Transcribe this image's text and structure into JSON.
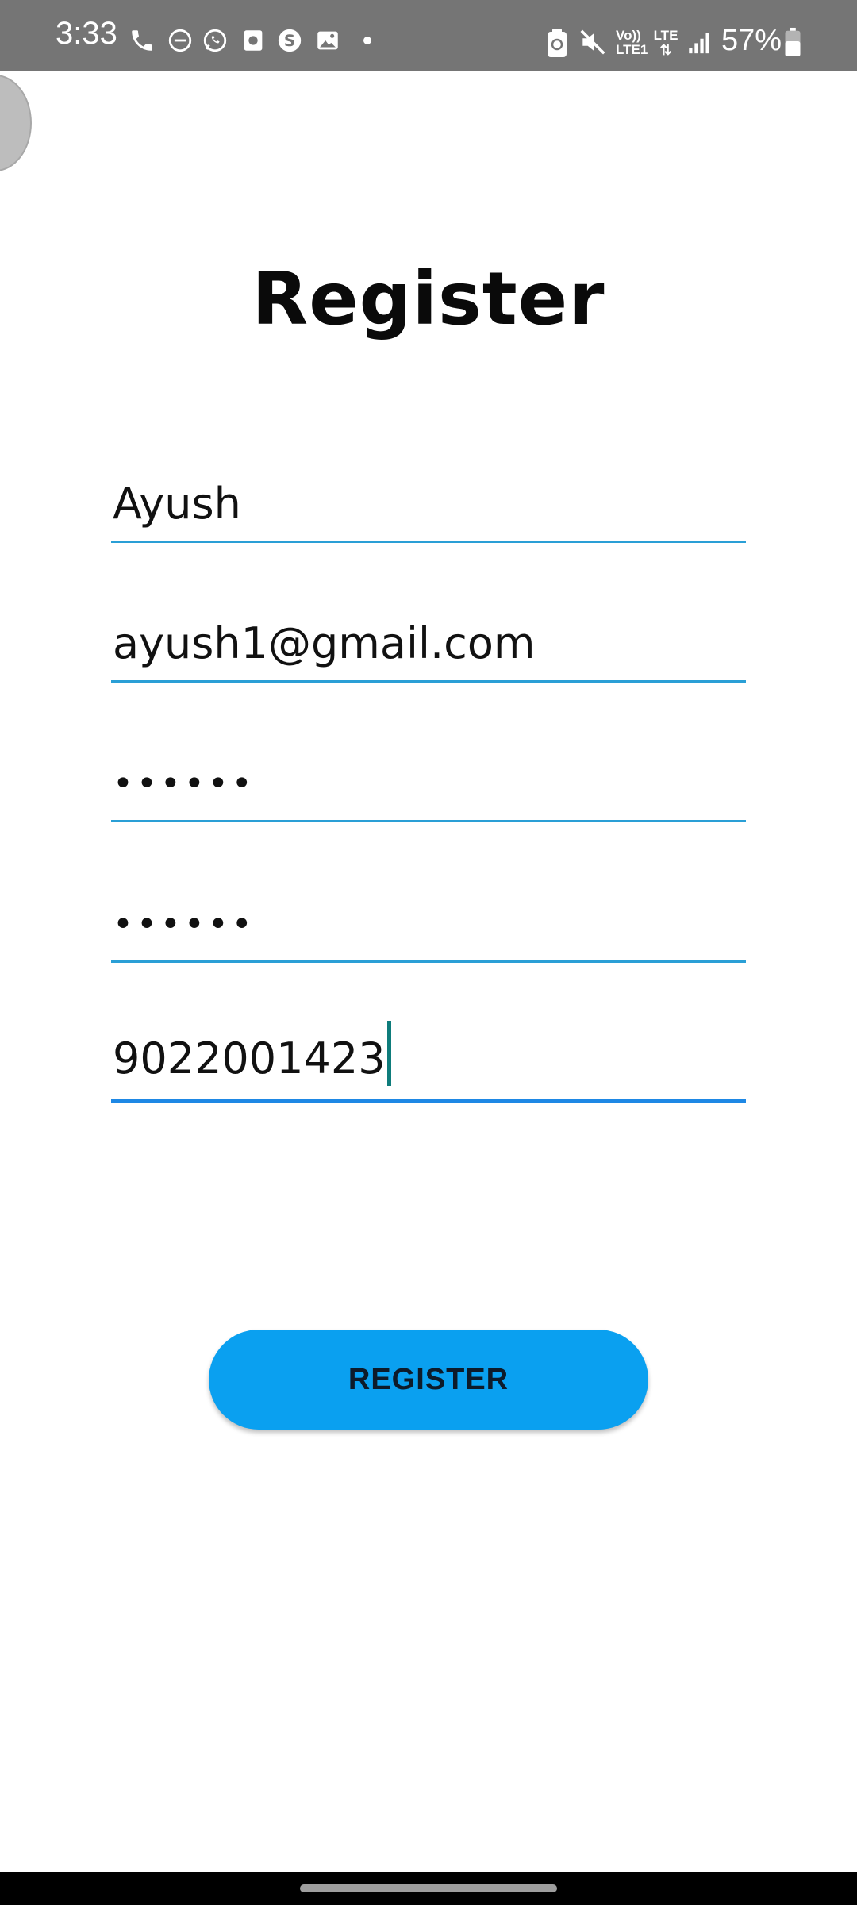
{
  "status_bar": {
    "time": "3:33",
    "battery_percent": "57%",
    "left_icons": [
      "phone-icon",
      "do-not-disturb-icon",
      "whatsapp-icon",
      "app-icon",
      "s-app-icon",
      "image-icon",
      "dot-icon"
    ],
    "right_icons": [
      "battery-saver-icon",
      "mute-icon",
      "volte-icon",
      "lte-icon",
      "signal-icon",
      "battery-icon"
    ],
    "network_label_1": "Vo))",
    "network_label_2": "LTE1",
    "network_label_3": "LTE"
  },
  "page": {
    "title": "Register"
  },
  "form": {
    "name_value": "Ayush",
    "email_value": "ayush1@gmail.com",
    "password_value": "••••••",
    "confirm_password_value": "••••••",
    "phone_value": "9022001423"
  },
  "actions": {
    "register_label": "REGISTER"
  },
  "colors": {
    "status_bar": "#757575",
    "underline": "#2a9fd6",
    "button": "#0aa0f0",
    "cursor": "#0e7c7b"
  }
}
